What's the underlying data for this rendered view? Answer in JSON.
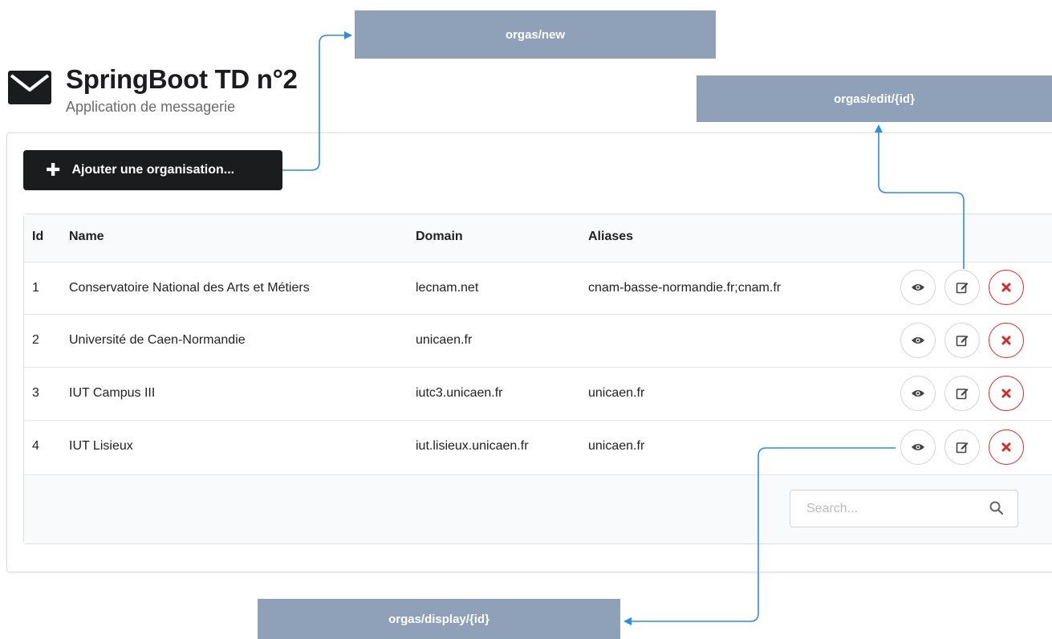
{
  "header": {
    "icon": "envelope-icon",
    "title": "SpringBoot TD n°2",
    "subtitle": "Application de messagerie"
  },
  "toolbar": {
    "add_label": "Ajouter une organisation...",
    "add_icon": "plus-icon"
  },
  "table": {
    "columns": [
      "Id",
      "Name",
      "Domain",
      "Aliases"
    ],
    "rows": [
      {
        "id": "1",
        "name": "Conservatoire National des Arts et Métiers",
        "domain": "lecnam.net",
        "aliases": "cnam-basse-normandie.fr;cnam.fr"
      },
      {
        "id": "2",
        "name": "Université de Caen-Normandie",
        "domain": "unicaen.fr",
        "aliases": ""
      },
      {
        "id": "3",
        "name": "IUT Campus III",
        "domain": "iutc3.unicaen.fr",
        "aliases": "unicaen.fr"
      },
      {
        "id": "4",
        "name": "IUT Lisieux",
        "domain": "iut.lisieux.unicaen.fr",
        "aliases": "unicaen.fr"
      }
    ],
    "row_actions": [
      "eye-icon",
      "edit-icon",
      "close-icon"
    ]
  },
  "search": {
    "placeholder": "Search...",
    "value": "",
    "icon": "search-icon"
  },
  "annotations": {
    "new": "orgas/new",
    "edit": "orgas/edit/{id}",
    "display": "orgas/display/{id}"
  },
  "colors": {
    "button_dark": "#1b1c1d",
    "delete_red": "#db2828",
    "callout_bg": "#8fa1b8",
    "arrow_blue": "#2b8ee8"
  }
}
